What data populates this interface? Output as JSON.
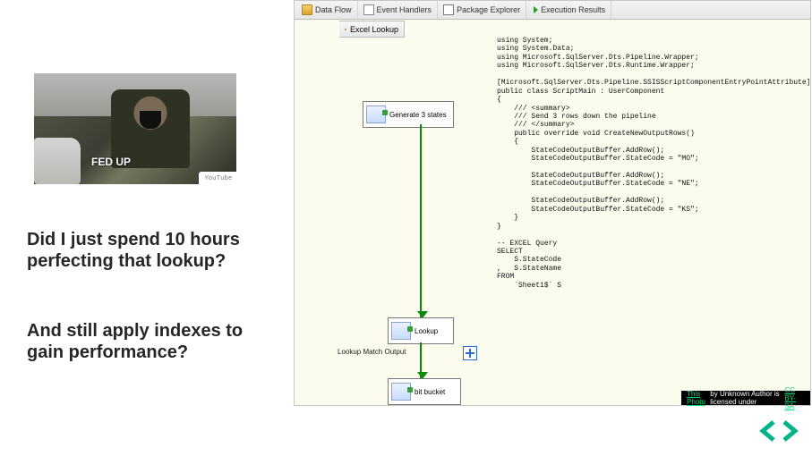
{
  "gif": {
    "caption": "FED UP",
    "watermark": "YouTube"
  },
  "question1": "Did I just spend 10 hours perfecting that lookup?",
  "question2": "And still apply indexes to gain performance?",
  "tabs": {
    "data_flow": "Data Flow",
    "event_handlers": "Event Handlers",
    "package_explorer": "Package Explorer",
    "execution_results": "Execution Results"
  },
  "sub_tab": "Excel Lookup",
  "nodes": {
    "generate": "Generate 3 states",
    "lookup": "Lookup",
    "bitbucket": "bit bucket"
  },
  "labels": {
    "lookup_output": "Lookup Match Output"
  },
  "code": "using System;\nusing System.Data;\nusing Microsoft.SqlServer.Dts.Pipeline.Wrapper;\nusing Microsoft.SqlServer.Dts.Runtime.Wrapper;\n\n[Microsoft.SqlServer.Dts.Pipeline.SSISScriptComponentEntryPointAttribute]\npublic class ScriptMain : UserComponent\n{\n    /// <summary>\n    /// Send 3 rows down the pipeline\n    /// </summary>\n    public override void CreateNewOutputRows()\n    {\n        StateCodeOutputBuffer.AddRow();\n        StateCodeOutputBuffer.StateCode = \"MO\";\n\n        StateCodeOutputBuffer.AddRow();\n        StateCodeOutputBuffer.StateCode = \"NE\";\n\n        StateCodeOutputBuffer.AddRow();\n        StateCodeOutputBuffer.StateCode = \"KS\";\n    }\n}\n\n-- EXCEL Query\nSELECT\n    S.StateCode\n,   S.StateName\nFROM\n    `Sheet1$` S",
  "attribution": {
    "link1": "This Photo",
    "mid": " by Unknown Author is licensed under ",
    "link2": "CC BY-SA"
  }
}
